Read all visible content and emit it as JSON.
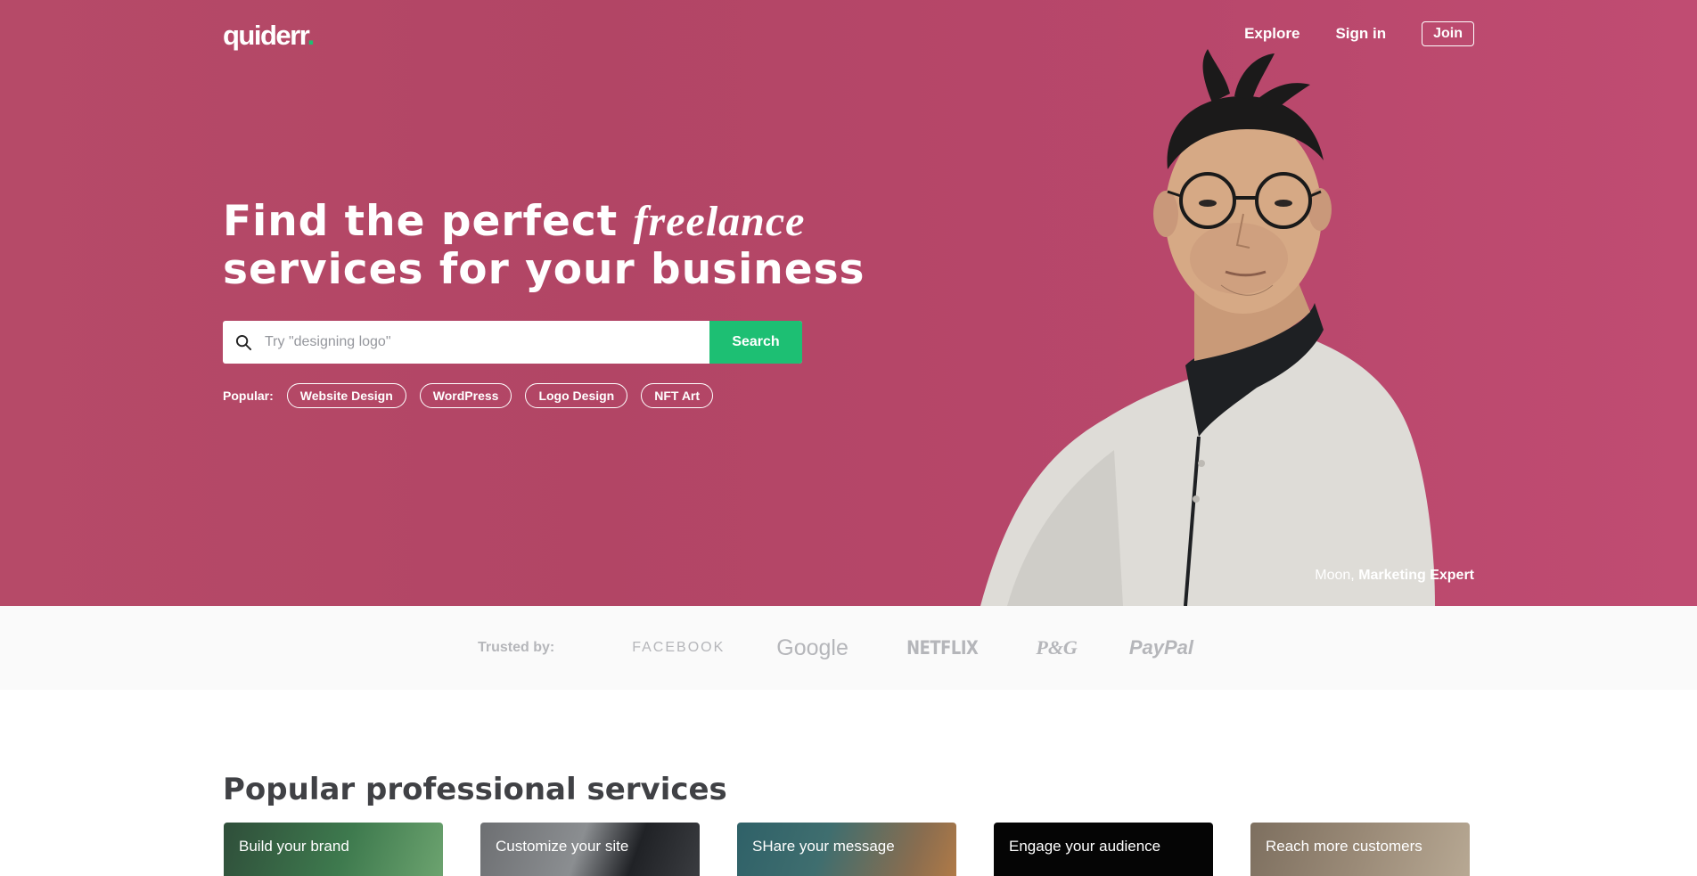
{
  "header": {
    "logo_text": "quiderr",
    "logo_dot": ".",
    "nav": {
      "explore": "Explore",
      "sign_in": "Sign in",
      "join": "Join"
    }
  },
  "hero": {
    "headline_part1": "Find the perfect ",
    "headline_italic": "freelance",
    "headline_line2": "services for your business",
    "search": {
      "placeholder": "Try \"designing logo\"",
      "value": "",
      "button_label": "Search"
    },
    "popular": {
      "label": "Popular:",
      "chips": [
        "Website Design",
        "WordPress",
        "Logo Design",
        "NFT Art"
      ]
    },
    "credit": {
      "name": "Moon,",
      "role": "Marketing Expert"
    },
    "background_color": "#b24565",
    "accent_color": "#1dbf73"
  },
  "trusted": {
    "label": "Trusted by:",
    "brands": [
      "FACEBOOK",
      "Google",
      "NETFLIX",
      "P&G",
      "PayPal"
    ]
  },
  "services": {
    "title": "Popular professional services",
    "cards": [
      "Build your brand",
      "Customize your site",
      "SHare your message",
      "Engage your audience",
      "Reach more customers"
    ]
  }
}
